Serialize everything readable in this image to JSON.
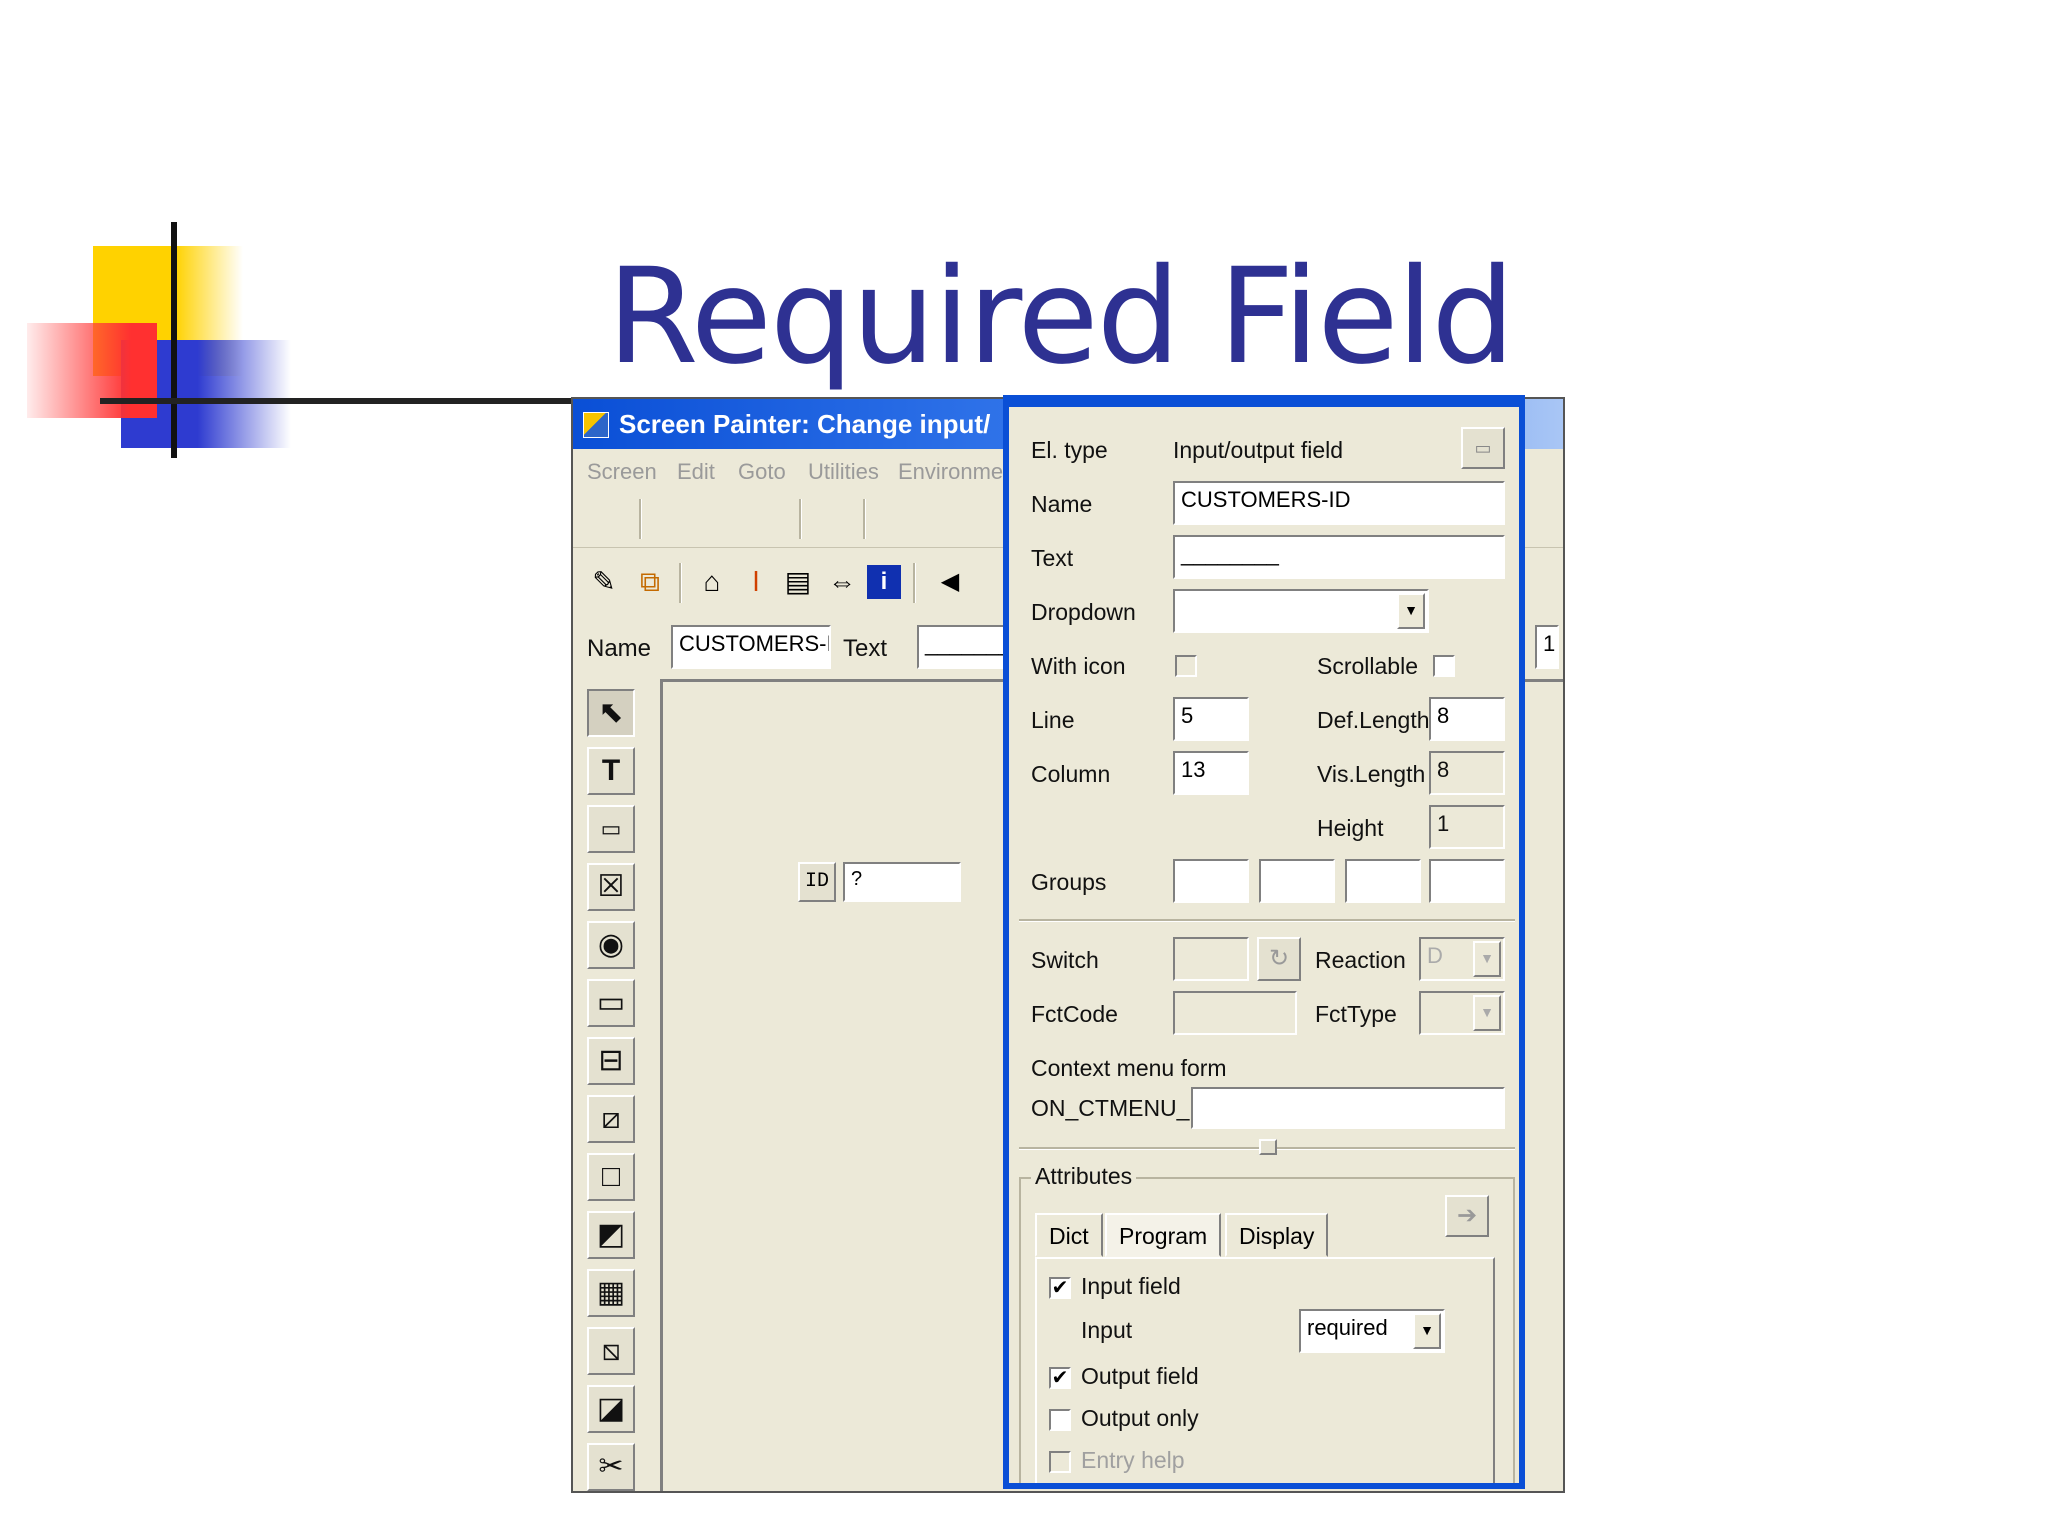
{
  "slide": {
    "title": "Required Field"
  },
  "window": {
    "title": "Screen Painter:  Change input/",
    "menu": [
      "Screen",
      "Edit",
      "Goto",
      "Utilities",
      "Environmen"
    ],
    "name_label": "Name",
    "name_value": "CUSTOMERS-II",
    "text_label": "Text",
    "text_value": "________",
    "right_edge_value": "1",
    "canvas": {
      "field_label": "ID",
      "field_value": "?"
    },
    "palette_icons": [
      "pointer-icon",
      "text-field-icon",
      "input-field-icon",
      "checkbox-icon",
      "radio-button-icon",
      "pushbutton-icon",
      "tab-strip-icon",
      "tab-strip-wizard-icon",
      "box-icon",
      "subscreen-icon",
      "table-control-icon",
      "table-wizard-icon",
      "custom-control-icon",
      "status-icon"
    ]
  },
  "dialog": {
    "el_type_label": "El. type",
    "el_type_value": "Input/output field",
    "name_label": "Name",
    "name_value": "CUSTOMERS-ID",
    "text_label": "Text",
    "text_value": "________",
    "dropdown_label": "Dropdown",
    "dropdown_value": "",
    "with_icon_label": "With icon",
    "scrollable_label": "Scrollable",
    "line_label": "Line",
    "line_value": "5",
    "column_label": "Column",
    "column_value": "13",
    "def_length_label": "Def.Length",
    "def_length_value": "8",
    "vis_length_label": "Vis.Length",
    "vis_length_value": "8",
    "height_label": "Height",
    "height_value": "1",
    "groups_label": "Groups",
    "switch_label": "Switch",
    "reaction_label": "Reaction",
    "reaction_value": "D",
    "fctcode_label": "FctCode",
    "fcttype_label": "FctType",
    "context_menu_label": "Context menu form",
    "on_ctmenu_label": "ON_CTMENU_",
    "attributes_label": "Attributes",
    "tabs": [
      "Dict",
      "Program",
      "Display"
    ],
    "input_field_label": "Input field",
    "input_field_checked": true,
    "input_label": "Input",
    "input_value": "required",
    "output_field_label": "Output field",
    "output_field_checked": true,
    "output_only_label": "Output only",
    "output_only_checked": false,
    "entry_help_label": "Entry help",
    "entry_help_checked": false
  },
  "colors": {
    "title": "#2e3192",
    "window_bg": "#ece9d8",
    "titlebar": "#0a4fd6"
  }
}
